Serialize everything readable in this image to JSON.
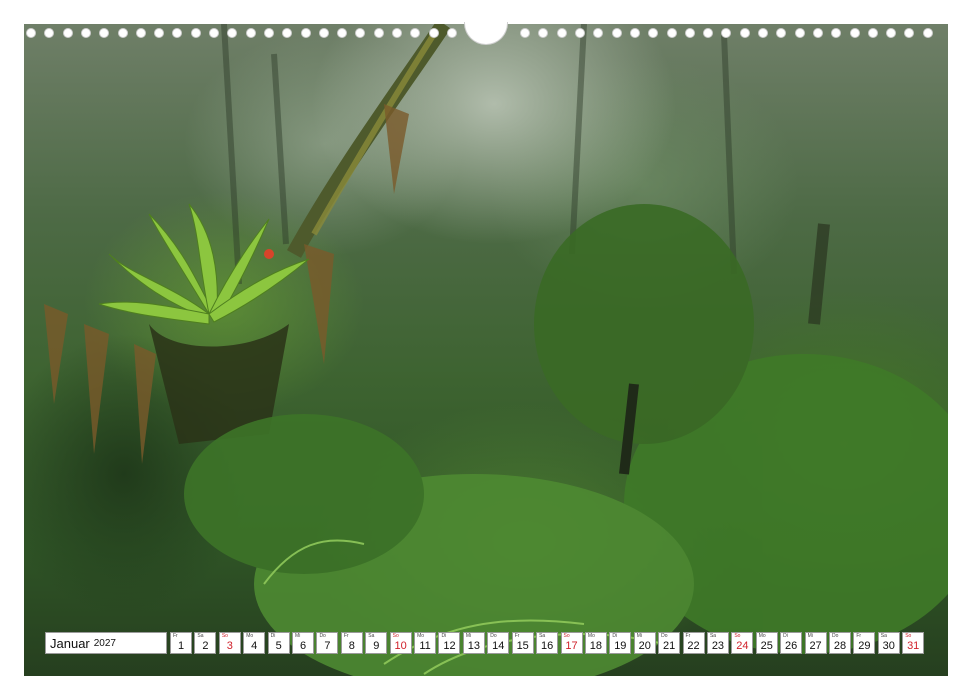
{
  "calendar": {
    "month": "Januar",
    "year": "2027",
    "days": [
      {
        "wd": "Fr",
        "n": "1",
        "sunday": false
      },
      {
        "wd": "Sa",
        "n": "2",
        "sunday": false
      },
      {
        "wd": "So",
        "n": "3",
        "sunday": true
      },
      {
        "wd": "Mo",
        "n": "4",
        "sunday": false
      },
      {
        "wd": "Di",
        "n": "5",
        "sunday": false
      },
      {
        "wd": "Mi",
        "n": "6",
        "sunday": false
      },
      {
        "wd": "Do",
        "n": "7",
        "sunday": false
      },
      {
        "wd": "Fr",
        "n": "8",
        "sunday": false
      },
      {
        "wd": "Sa",
        "n": "9",
        "sunday": false
      },
      {
        "wd": "So",
        "n": "10",
        "sunday": true
      },
      {
        "wd": "Mo",
        "n": "11",
        "sunday": false
      },
      {
        "wd": "Di",
        "n": "12",
        "sunday": false
      },
      {
        "wd": "Mi",
        "n": "13",
        "sunday": false
      },
      {
        "wd": "Do",
        "n": "14",
        "sunday": false
      },
      {
        "wd": "Fr",
        "n": "15",
        "sunday": false
      },
      {
        "wd": "Sa",
        "n": "16",
        "sunday": false
      },
      {
        "wd": "So",
        "n": "17",
        "sunday": true
      },
      {
        "wd": "Mo",
        "n": "18",
        "sunday": false
      },
      {
        "wd": "Di",
        "n": "19",
        "sunday": false
      },
      {
        "wd": "Mi",
        "n": "20",
        "sunday": false
      },
      {
        "wd": "Do",
        "n": "21",
        "sunday": false
      },
      {
        "wd": "Fr",
        "n": "22",
        "sunday": false
      },
      {
        "wd": "Sa",
        "n": "23",
        "sunday": false
      },
      {
        "wd": "So",
        "n": "24",
        "sunday": true
      },
      {
        "wd": "Mo",
        "n": "25",
        "sunday": false
      },
      {
        "wd": "Di",
        "n": "26",
        "sunday": false
      },
      {
        "wd": "Mi",
        "n": "27",
        "sunday": false
      },
      {
        "wd": "Do",
        "n": "28",
        "sunday": false
      },
      {
        "wd": "Fr",
        "n": "29",
        "sunday": false
      },
      {
        "wd": "Sa",
        "n": "30",
        "sunday": false
      },
      {
        "wd": "So",
        "n": "31",
        "sunday": true
      }
    ]
  },
  "photo": {
    "subject": "misty rainforest with ferns, mosses and a bromeliad",
    "colors": {
      "canopy": "#3d6330",
      "mist": "#c3ccbf",
      "leaf": "#7fb83a",
      "sunday": "#d0202a"
    }
  }
}
